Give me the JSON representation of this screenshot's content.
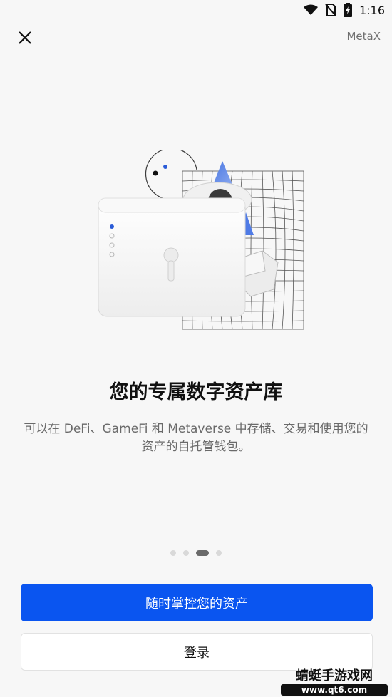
{
  "status_bar": {
    "time": "1:16"
  },
  "header": {
    "brand": "MetaX"
  },
  "onboarding": {
    "title": "您的专属数字资产库",
    "description": "可以在 DeFi、GameFi 和 Metaverse 中存储、交易和使用您的资产的自托管钱包。",
    "pages_total": 4,
    "current_page_index": 2
  },
  "actions": {
    "primary_label": "随时掌控您的资产",
    "secondary_label": "登录"
  },
  "watermark": {
    "line1": "蜻蜓手游戏网",
    "line2": "www.qt6.com"
  },
  "colors": {
    "primary": "#0a55f0",
    "accent_blue": "#2a5bd7",
    "background": "#f7f7f7"
  }
}
